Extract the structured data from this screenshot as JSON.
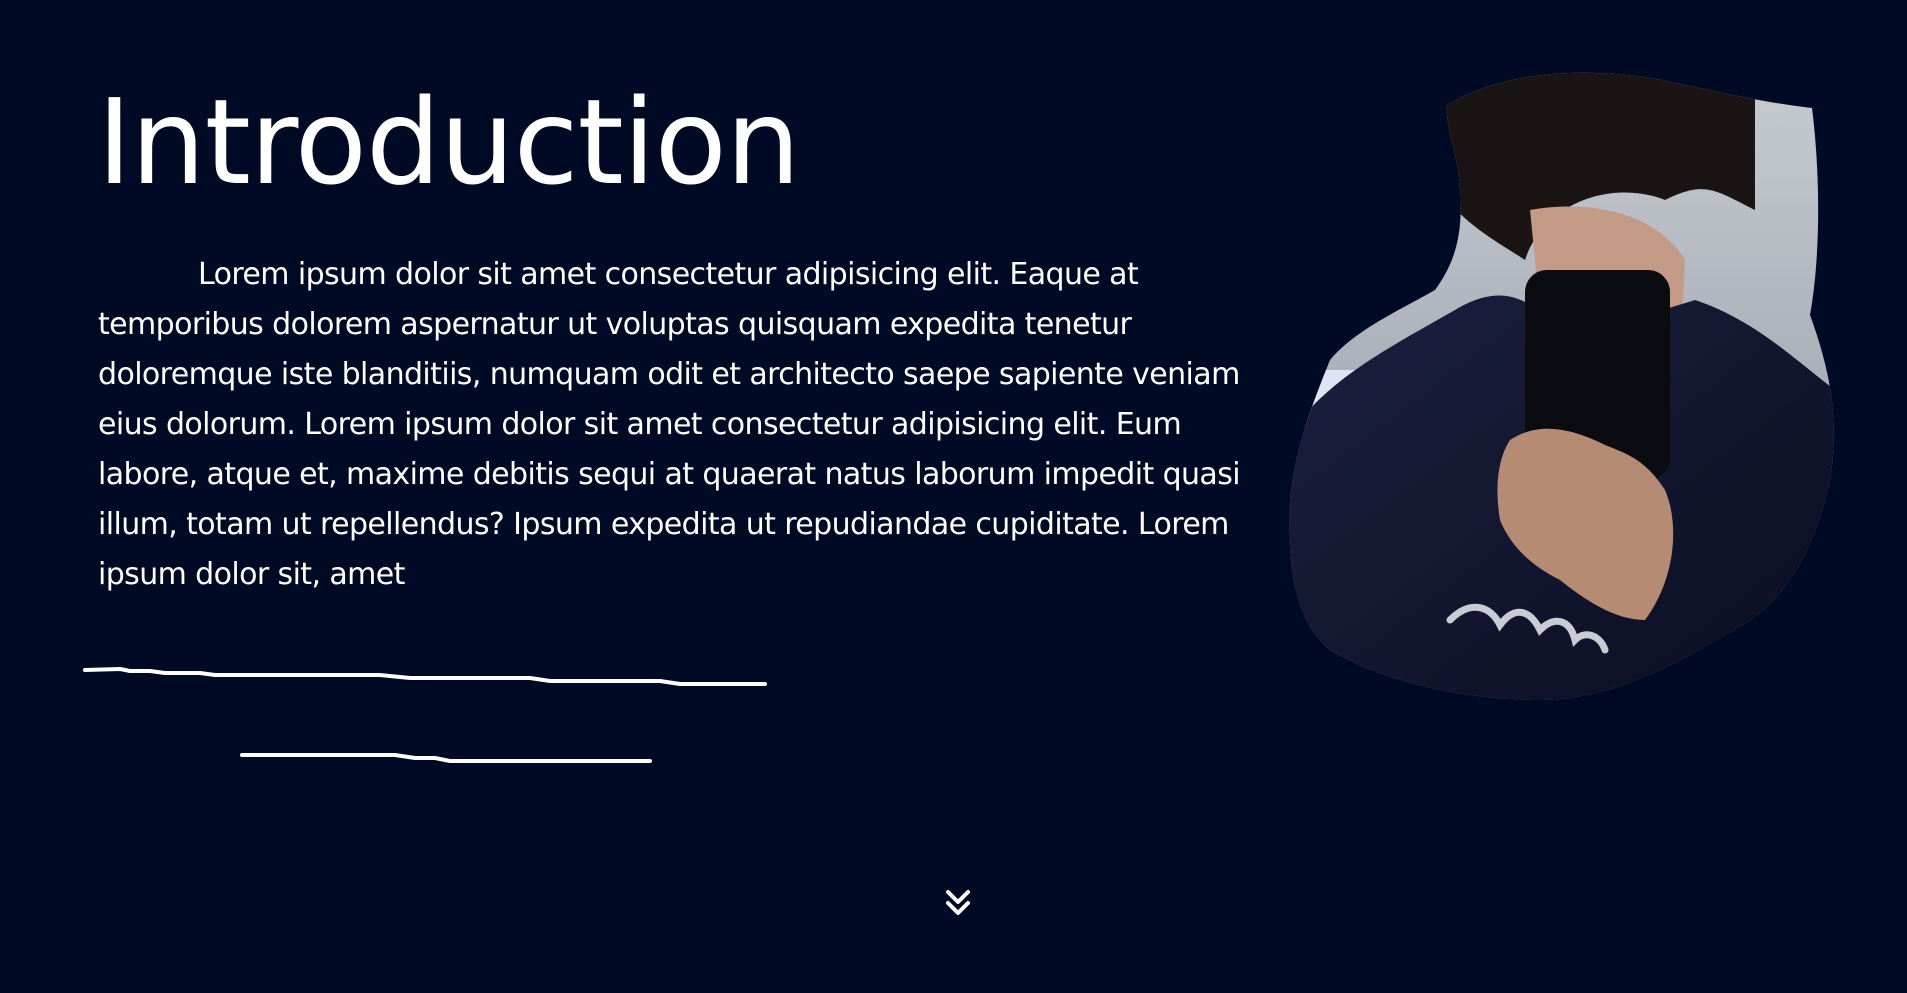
{
  "intro": {
    "title": "Introduction",
    "paragraph": "Lorem ipsum dolor sit amet consectetur adipisicing elit. Eaque at temporibus dolorem aspernatur ut voluptas quisquam expedita tenetur doloremque iste blanditiis, numquam odit et architecto saepe sapiente veniam eius dolorum. Lorem ipsum dolor sit amet consectetur adipisicing elit. Eum labore, atque et, maxime debitis sequi at quaerat natus laborum impedit quasi illum, totam ut repellendus? Ipsum expedita ut repudiandae cupiditate. Lorem ipsum dolor sit, amet"
  },
  "decorations": {
    "underline_icon": "hand-drawn-lines",
    "portrait_image": "person-mirror-selfie-blob"
  },
  "scroll": {
    "icon": "double-chevron-down-icon"
  },
  "colors": {
    "background": "#010a24",
    "text": "#ffffff",
    "accent": "#ffffff"
  }
}
